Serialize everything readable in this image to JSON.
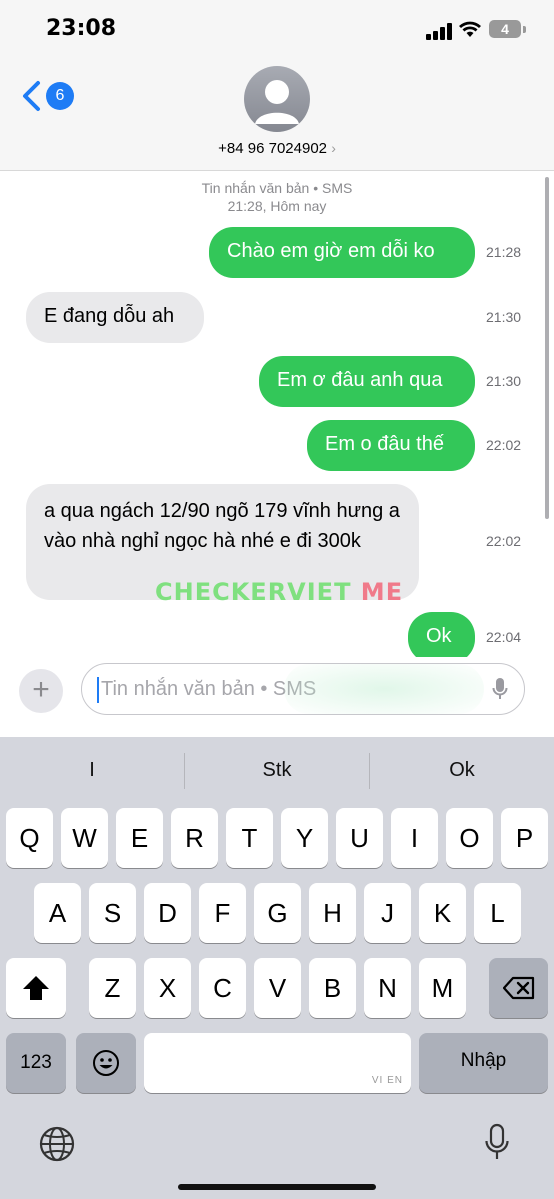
{
  "status_bar": {
    "time": "23:08",
    "battery": "4"
  },
  "header": {
    "back_count": "6",
    "contact": "+84 96 7024902",
    "contact_chevron": "›"
  },
  "conversation": {
    "meta_line1": "Tin nhắn văn bản • SMS",
    "meta_line2": "21:28, Hôm nay",
    "messages": [
      {
        "text": "Chào em giờ em dỗi ko",
        "time": "21:28",
        "sender": "me"
      },
      {
        "text": "E đang dỗu ah",
        "time": "21:30",
        "sender": "them"
      },
      {
        "text": "Em ơ đâu anh qua",
        "time": "21:30",
        "sender": "me"
      },
      {
        "text": "Em o đâu thế",
        "time": "22:02",
        "sender": "me"
      },
      {
        "text": "a qua ngách 12/90 ngõ 179 vĩnh hưng a vào nhà nghỉ ngọc hà nhé e đi 300k",
        "time": "22:02",
        "sender": "them"
      },
      {
        "text": "Ok",
        "time": "22:04",
        "sender": "me"
      }
    ],
    "watermark_1": "CHECKERVIET",
    "watermark_2": " ME"
  },
  "input": {
    "placeholder": "Tin nhắn văn bản • SMS",
    "plus": "+"
  },
  "keyboard": {
    "suggestions": [
      "I",
      "Stk",
      "Ok"
    ],
    "row1": [
      "Q",
      "W",
      "E",
      "R",
      "T",
      "Y",
      "U",
      "I",
      "O",
      "P"
    ],
    "row2": [
      "A",
      "S",
      "D",
      "F",
      "G",
      "H",
      "J",
      "K",
      "L"
    ],
    "row3": [
      "Z",
      "X",
      "C",
      "V",
      "B",
      "N",
      "M"
    ],
    "numbers_label": "123",
    "return_label": "Nhập",
    "space_hint": "VI EN"
  },
  "colors": {
    "sent": "#33c759",
    "received": "#e9e9eb",
    "accent": "#1e7cf5"
  },
  "icons": [
    "signal-icon",
    "wifi-icon",
    "battery-icon",
    "back-chevron-icon",
    "avatar-icon",
    "plus-icon",
    "mic-icon",
    "shift-icon",
    "delete-icon",
    "emoji-icon",
    "globe-icon",
    "dictation-icon"
  ]
}
